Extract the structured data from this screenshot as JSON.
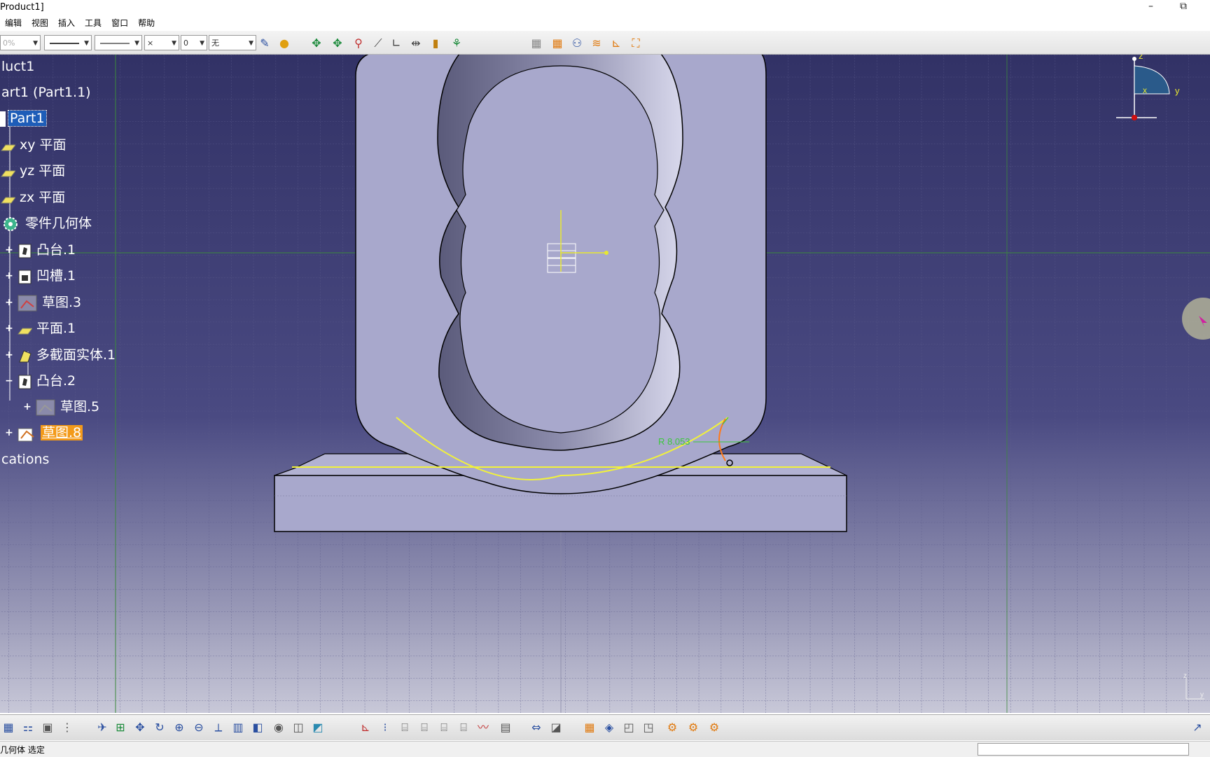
{
  "window": {
    "title": "Product1]",
    "minimize_glyph": "–",
    "restore_glyph": "⧉"
  },
  "menu": [
    "编辑",
    "视图",
    "插入",
    "工具",
    "窗口",
    "帮助"
  ],
  "toolbar_top": {
    "zoom_value": "0%",
    "point_type": "×",
    "layer_value": "0",
    "layer_name": "无"
  },
  "tree": {
    "items": [
      {
        "label": "luct1"
      },
      {
        "label": "art1 (Part1.1)"
      },
      {
        "label": "Part1",
        "state": "selected-blue"
      },
      {
        "label": "xy 平面"
      },
      {
        "label": "yz 平面"
      },
      {
        "label": "zx 平面"
      },
      {
        "label": "零件几何体"
      },
      {
        "label": "凸台.1"
      },
      {
        "label": "凹槽.1"
      },
      {
        "label": "草图.3"
      },
      {
        "label": "平面.1"
      },
      {
        "label": "多截面实体.1"
      },
      {
        "label": "凸台.2"
      },
      {
        "label": "草图.5"
      },
      {
        "label": "草图.8",
        "state": "selected-orange"
      },
      {
        "label": "cations"
      }
    ]
  },
  "viewport": {
    "dimension_label": "R 8.053",
    "compass": {
      "z": "z",
      "x": "x",
      "y": "y"
    },
    "axis_mini": {
      "z": "z",
      "y": "y"
    },
    "colors": {
      "bg_top": "#323266",
      "part_fill": "#a8a8cc",
      "sketch_yellow": "#f2f23a",
      "dim_green": "#3cc83c",
      "arc_orange": "#ff7a1a"
    }
  },
  "status": {
    "text": "几何体 选定"
  }
}
